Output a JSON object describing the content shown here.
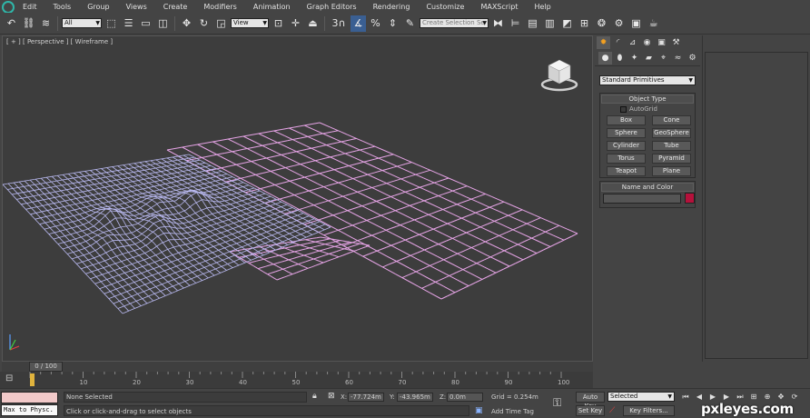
{
  "menu": [
    "Edit",
    "Tools",
    "Group",
    "Views",
    "Create",
    "Modifiers",
    "Animation",
    "Graph Editors",
    "Rendering",
    "Customize",
    "MAXScript",
    "Help"
  ],
  "toolbar": {
    "selection_filter": "All",
    "ref_coord": "View",
    "snap_value": "3",
    "named_selection": "Create Selection Se"
  },
  "viewport": {
    "label": "[ + ] [ Perspective ] [ Wireframe ]"
  },
  "command_panel": {
    "category": "Standard Primitives",
    "object_type_title": "Object Type",
    "autogrid_label": "AutoGrid",
    "primitives": [
      "Box",
      "Cone",
      "Sphere",
      "GeoSphere",
      "Cylinder",
      "Tube",
      "Torus",
      "Pyramid",
      "Teapot",
      "Plane"
    ],
    "name_color_title": "Name and Color",
    "object_color": "#b5113b"
  },
  "timeline": {
    "frame_label": "0 / 100",
    "ticks": [
      "10",
      "20",
      "30",
      "40",
      "50",
      "60",
      "70",
      "80",
      "90",
      "100"
    ]
  },
  "status": {
    "maxscript_output": "Max to Physc.",
    "selection_status": "None Selected",
    "prompt": "Click or click-and-drag to select objects",
    "x_label": "X:",
    "x_value": "-77.724m",
    "y_label": "Y:",
    "y_value": "-43.965m",
    "z_label": "Z:",
    "z_value": "0.0m",
    "grid": "Grid = 0.254m",
    "add_time_tag": "Add Time Tag",
    "auto_key": "Auto Key",
    "set_key": "Set Key",
    "set_key_filter": "Selected",
    "key_filters": "Key Filters..."
  },
  "watermark": "pxleyes.com",
  "colors": {
    "wire_blue": "#b9b9f0",
    "wire_pink": "#e6a4e6",
    "ui_bg": "#444444",
    "viewport_bg": "#3d3d3d"
  }
}
